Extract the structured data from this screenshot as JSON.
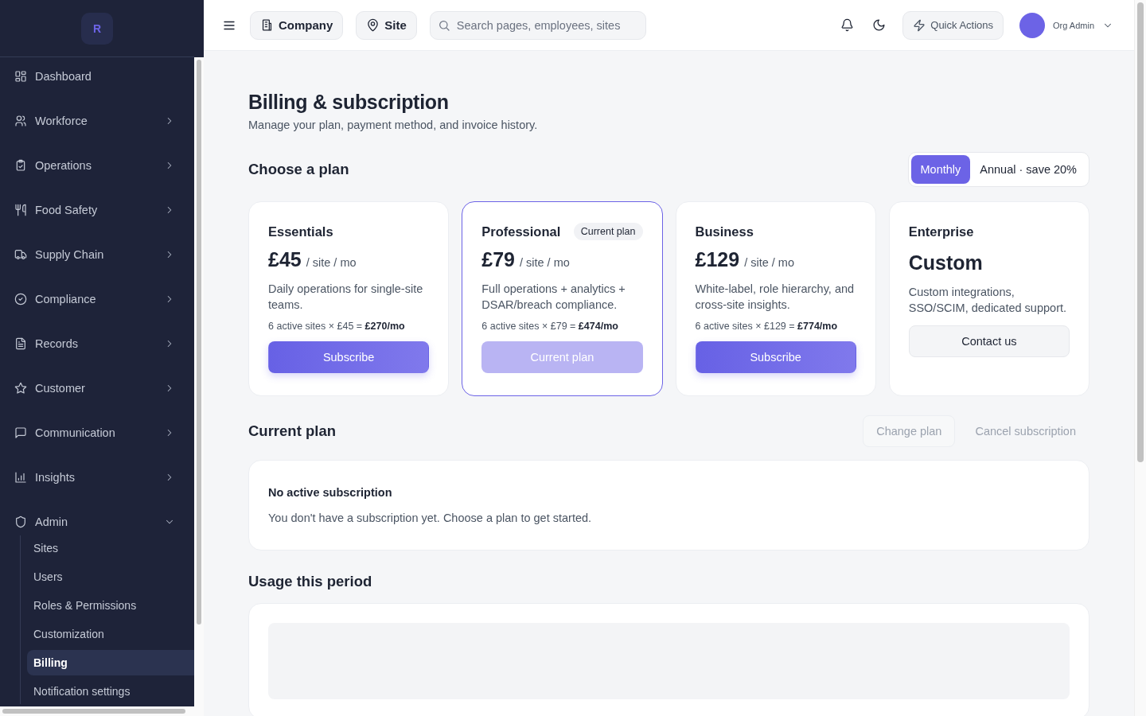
{
  "sidebar": {
    "logo": "R",
    "items": [
      {
        "label": "Dashboard",
        "kind": "link"
      },
      {
        "label": "Workforce",
        "kind": "group",
        "expanded": false
      },
      {
        "label": "Operations",
        "kind": "group",
        "expanded": false
      },
      {
        "label": "Food Safety",
        "kind": "group",
        "expanded": false
      },
      {
        "label": "Supply Chain",
        "kind": "group",
        "expanded": false
      },
      {
        "label": "Compliance",
        "kind": "group",
        "expanded": false
      },
      {
        "label": "Records",
        "kind": "group",
        "expanded": false
      },
      {
        "label": "Customer",
        "kind": "group",
        "expanded": false
      },
      {
        "label": "Communication",
        "kind": "group",
        "expanded": false
      },
      {
        "label": "Insights",
        "kind": "group",
        "expanded": false
      },
      {
        "label": "Admin",
        "kind": "group",
        "expanded": true,
        "children": [
          {
            "label": "Sites",
            "selected": false
          },
          {
            "label": "Users",
            "selected": false
          },
          {
            "label": "Roles & Permissions",
            "selected": false
          },
          {
            "label": "Customization",
            "selected": false
          },
          {
            "label": "Billing",
            "selected": true
          },
          {
            "label": "Notification settings",
            "selected": false
          }
        ]
      }
    ]
  },
  "topbar": {
    "company": "Company",
    "site": "Site",
    "search": {
      "placeholder": "Search pages, employees, sites"
    },
    "quick_actions": "Quick Actions",
    "user": "Org Admin"
  },
  "page": {
    "title": "Billing & subscription",
    "subtitle": "Manage your plan, payment method, and invoice history.",
    "plans_section": {
      "title": "Choose a plan",
      "periods": [
        {
          "label": "Monthly",
          "selected": true
        },
        {
          "label": "Annual · save 20%",
          "selected": false
        }
      ],
      "plans": [
        {
          "name": "Essentials",
          "price": "£45",
          "unit": "/ site / mo",
          "description": "Daily operations for single-site teams.",
          "total": "6 active sites × £45 = **£270/mo**",
          "current": false,
          "button": {
            "label": "Subscribe",
            "kind": "primary"
          }
        },
        {
          "name": "Professional",
          "badge": "Current plan",
          "price": "£79",
          "unit": "/ site / mo",
          "description": "Full operations + analytics + DSAR/breach compliance.",
          "total": "6 active sites × £79 = **£474/mo**",
          "current": true,
          "button": {
            "label": "Current plan",
            "kind": "disabled"
          }
        },
        {
          "name": "Business",
          "price": "£129",
          "unit": "/ site / mo",
          "description": "White-label, role hierarchy, and cross-site insights.",
          "total": "6 active sites × £129 = **£774/mo**",
          "current": false,
          "button": {
            "label": "Subscribe",
            "kind": "primary"
          }
        },
        {
          "name": "Enterprise",
          "price": "Custom",
          "description": "Custom integrations, SSO/SCIM, dedicated support.",
          "current": false,
          "button": {
            "label": "Contact us",
            "kind": "secondary"
          }
        }
      ]
    },
    "current_section": {
      "title": "Current plan",
      "actions": [
        {
          "label": "Change plan",
          "kind": "outline",
          "disabled": true
        },
        {
          "label": "Cancel subscription",
          "kind": "ghost",
          "disabled": true
        }
      ],
      "heading": "No active subscription",
      "text": "You don't have a subscription yet. Choose a plan to get started."
    },
    "usage_section": {
      "title": "Usage this period"
    }
  }
}
